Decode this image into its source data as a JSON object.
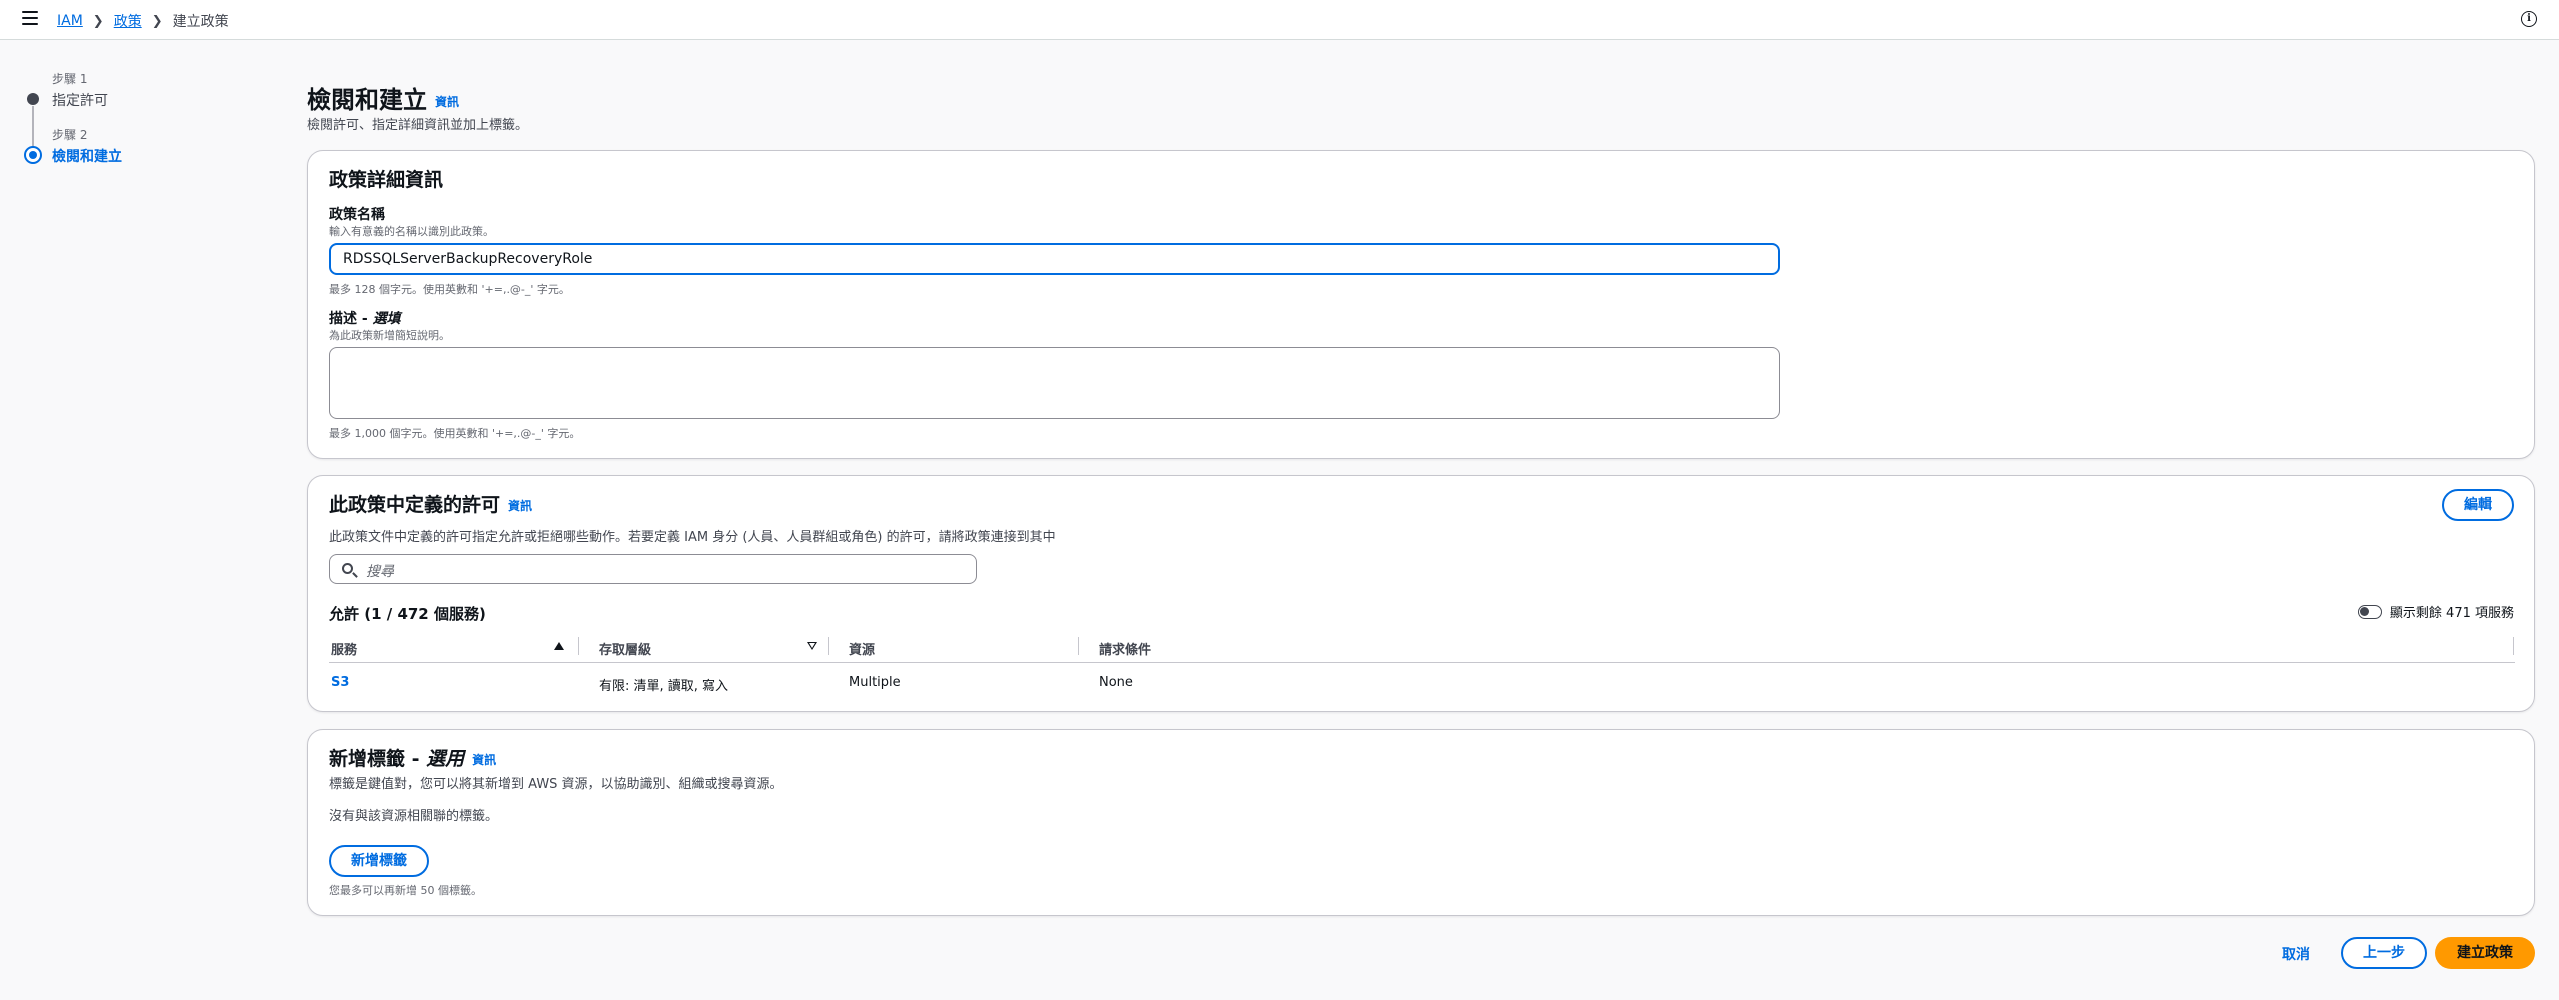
{
  "breadcrumb": {
    "items": [
      "IAM",
      "政策",
      "建立政策"
    ]
  },
  "steps": [
    {
      "small": "步驟 1",
      "label": "指定許可"
    },
    {
      "small": "步驟 2",
      "label": "檢閱和建立"
    }
  ],
  "page": {
    "title": "檢閱和建立",
    "info": "資訊",
    "description": "檢閱許可、指定詳細資訊並加上標籤。"
  },
  "policy_details": {
    "title": "政策詳細資訊",
    "name_label": "政策名稱",
    "name_description": "輸入有意義的名稱以識別此政策。",
    "name_value": "RDSSQLServerBackupRecoveryRole",
    "name_constraint": "最多 128 個字元。使用英數和 '+=,.@-_' 字元。",
    "desc_label": "描述 - ",
    "desc_label_optional": "選填",
    "desc_description": "為此政策新增簡短說明。",
    "desc_value": "",
    "desc_constraint": "最多 1,000 個字元。使用英數和 '+=,.@-_' 字元。"
  },
  "permissions": {
    "title": "此政策中定義的許可",
    "info": "資訊",
    "description": "此政策文件中定義的許可指定允許或拒絕哪些動作。若要定義 IAM 身分 (人員、人員群組或角色) 的許可，請將政策連接到其中",
    "edit_button": "編輯",
    "search_placeholder": "搜尋",
    "count_title": "允許 (1 / 472 個服務)",
    "toggle_label": "顯示剩餘 471 項服務",
    "columns": [
      "服務",
      "存取層級",
      "資源",
      "請求條件"
    ],
    "rows": [
      {
        "service": "S3",
        "access": "有限: 清單, 讀取, 寫入",
        "resource": "Multiple",
        "condition": "None"
      }
    ]
  },
  "tags": {
    "title": "新增標籤 - ",
    "title_optional": "選用",
    "info": "資訊",
    "description": "標籤是鍵值對，您可以將其新增到 AWS 資源，以協助識別、組織或搜尋資源。",
    "empty": "沒有與該資源相關聯的標籤。",
    "add_button": "新增標籤",
    "limit": "您最多可以再新增 50 個標籤。"
  },
  "footer": {
    "cancel": "取消",
    "previous": "上一步",
    "create": "建立政策"
  }
}
